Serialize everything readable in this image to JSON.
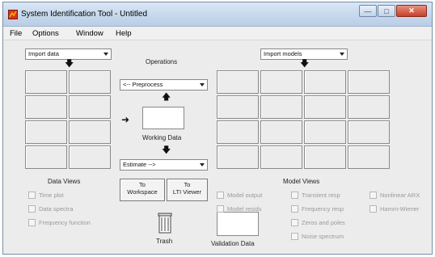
{
  "window": {
    "title": "System Identification Tool - Untitled"
  },
  "menu": {
    "items": [
      "File",
      "Options",
      "Window",
      "Help"
    ]
  },
  "data_panel": {
    "import_dropdown": "Import data",
    "views_title": "Data Views",
    "views": [
      "Time plot",
      "Data spectra",
      "Frequency function"
    ]
  },
  "operations": {
    "title": "Operations",
    "preprocess_dropdown": "<-- Preprocess",
    "working_label": "Working Data",
    "estimate_dropdown": "Estimate -->",
    "to_workspace": [
      "To",
      "Workspace"
    ],
    "to_lti": [
      "To",
      "LTI Viewer"
    ],
    "trash_label": "Trash",
    "validation_label": "Validation Data"
  },
  "model_panel": {
    "import_dropdown": "Import models",
    "views_title": "Model Views",
    "views_col1": [
      "Model output",
      "Model resids"
    ],
    "views_col2": [
      "Transient resp",
      "Frequency resp",
      "Zeros and poles",
      "Noise spectrum"
    ],
    "views_col3": [
      "Nonlinear ARX",
      "Hamm-Wiener"
    ]
  },
  "colors": {
    "title_gradient_top": "#d9e6f5",
    "close_button": "#c7402a",
    "disabled_text": "#9a9a9a"
  }
}
